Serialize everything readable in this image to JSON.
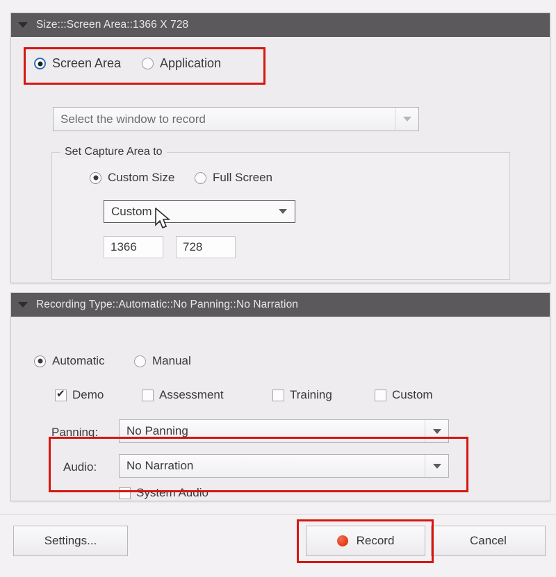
{
  "window": {
    "background_color": "#f3f1f3"
  },
  "size_panel": {
    "title": "Size:::Screen Area::1366 X 728",
    "collapse_icon": "triangle-down-icon",
    "source_radios": [
      {
        "label": "Screen Area",
        "selected": true
      },
      {
        "label": "Application",
        "selected": false
      }
    ],
    "window_select": {
      "value": "Select the window to record",
      "enabled": false,
      "arrow_icon": "chevron-down-icon"
    },
    "capture_area": {
      "legend": "Set Capture Area to",
      "radios": [
        {
          "label": "Custom Size",
          "selected": true
        },
        {
          "label": "Full Screen",
          "selected": false
        }
      ],
      "preset": {
        "value": "Custom",
        "arrow_icon": "chevron-down-icon"
      },
      "width_field": {
        "value": "1366"
      },
      "height_field": {
        "value": "728"
      }
    }
  },
  "recording_panel": {
    "title": "Recording Type::Automatic::No Panning::No Narration",
    "collapse_icon": "triangle-down-icon",
    "mode_radios": [
      {
        "label": "Automatic",
        "selected": true
      },
      {
        "label": "Manual",
        "selected": false
      }
    ],
    "type_checkboxes": [
      {
        "label": "Demo",
        "checked": true
      },
      {
        "label": "Assessment",
        "checked": false
      },
      {
        "label": "Training",
        "checked": false
      },
      {
        "label": "Custom",
        "checked": false
      }
    ],
    "panning": {
      "label": "Panning:",
      "value": "No Panning",
      "arrow_icon": "chevron-down-icon"
    },
    "audio": {
      "label": "Audio:",
      "value": "No Narration",
      "arrow_icon": "chevron-down-icon",
      "system_audio": {
        "label": "System Audio",
        "checked": false
      }
    }
  },
  "footer": {
    "settings_label": "Settings...",
    "record_label": "Record",
    "record_icon": "record-dot-icon",
    "cancel_label": "Cancel"
  },
  "annotations": {
    "color": "#d8150f",
    "boxes": [
      {
        "name": "source-radios-highlight"
      },
      {
        "name": "audio-group-highlight"
      },
      {
        "name": "record-button-highlight"
      }
    ]
  },
  "cursor": {
    "icon": "mouse-pointer-icon"
  }
}
